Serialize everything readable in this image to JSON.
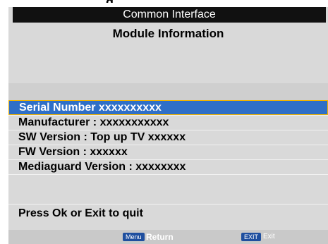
{
  "top_cut_text": "g",
  "header": {
    "title": "Common Interface",
    "subtitle": "Module Information"
  },
  "rows": [
    {
      "label": "Serial Number xxxxxxxxxx",
      "selected": true
    },
    {
      "label": "Manufacturer : xxxxxxxxxxx",
      "selected": false
    },
    {
      "label": "SW Version : Top up TV xxxxxx",
      "selected": false
    },
    {
      "label": "FW Version : xxxxxx",
      "selected": false
    },
    {
      "label": "Mediaguard Version : xxxxxxxx",
      "selected": false
    },
    {
      "label": "",
      "selected": false
    },
    {
      "label": "Press Ok or Exit to quit",
      "selected": false
    }
  ],
  "footer": {
    "menu_key": "Menu",
    "menu_action": "Return",
    "exit_key": "EXIT",
    "exit_action": "Exit"
  },
  "colors": {
    "osd_bg": "#d9d9d9",
    "title_bar": "#111111",
    "selection": "#2f6fc7",
    "selection_border": "#f2b400",
    "key_bg": "#1f4f9f"
  }
}
